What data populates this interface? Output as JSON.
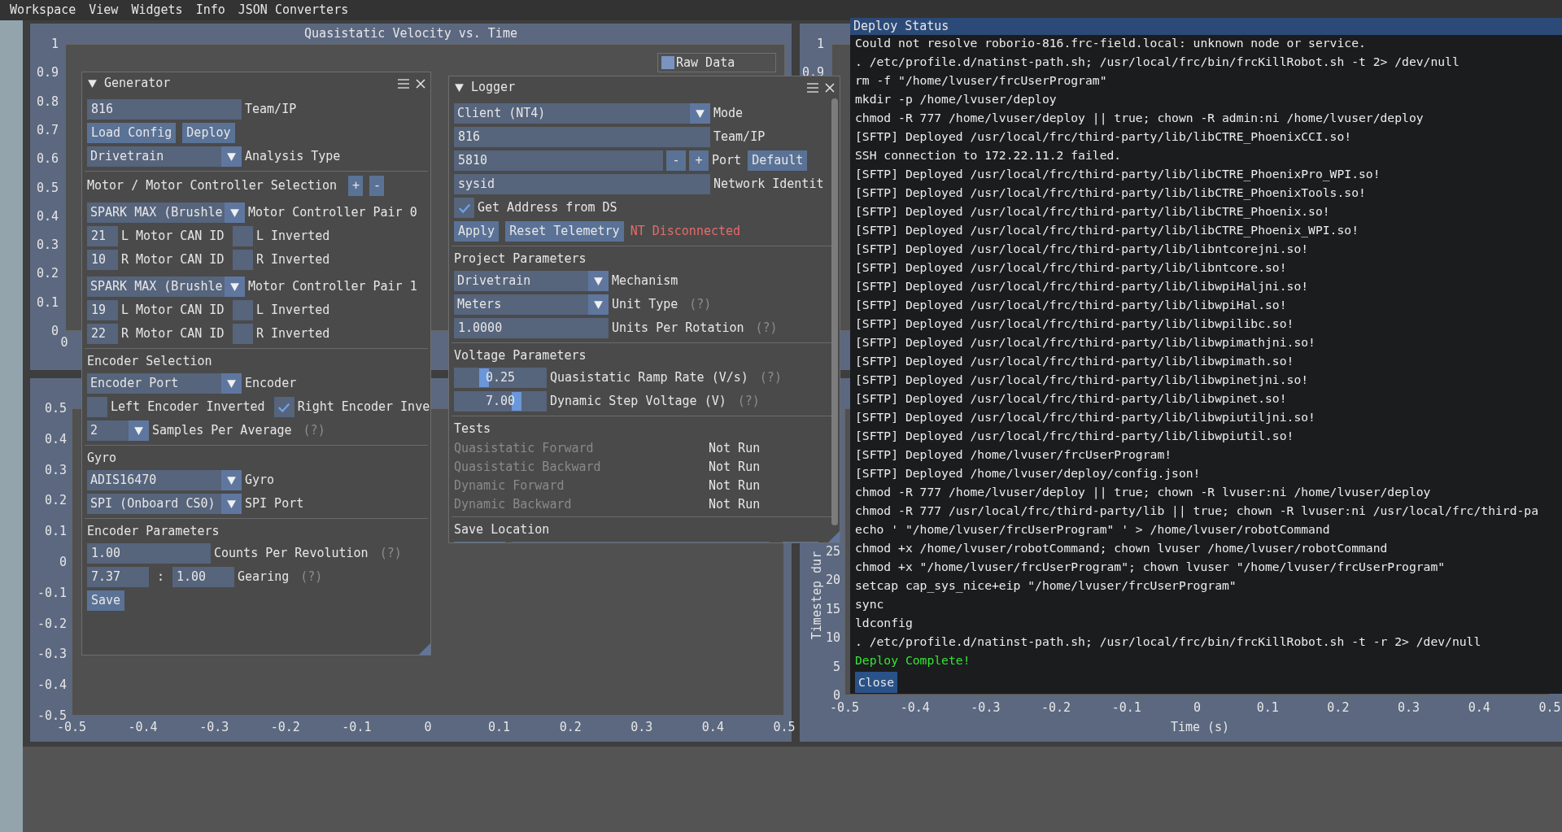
{
  "menu_bar": [
    "Workspace",
    "View",
    "Widgets",
    "Info",
    "JSON Converters"
  ],
  "plots": [
    {
      "title": "Quasistatic Velocity vs. Time",
      "y_ticks": [
        "1",
        "0.9",
        "0.8",
        "0.7",
        "0.6",
        "0.5",
        "0.4",
        "0.3",
        "0.2",
        "0.1",
        "0"
      ],
      "x_ticks": [
        "0"
      ],
      "legend": [
        {
          "label": "Raw Data",
          "color": "#7a93bf"
        }
      ]
    },
    {
      "y_ticks": [
        "1",
        "0.9"
      ]
    },
    {
      "y_ticks": [
        "0.5",
        "0.4",
        "0.3",
        "0.2",
        "0.1",
        "0",
        "-0.1",
        "-0.2",
        "-0.3",
        "-0.4",
        "-0.5"
      ],
      "x_ticks": [
        "-0.5",
        "-0.4",
        "-0.3",
        "-0.2",
        "-0.1",
        "0",
        "0.1",
        "0.2",
        "0.3",
        "0.4",
        "0.5"
      ]
    },
    {
      "y_ticks": [
        "25",
        "20",
        "15",
        "10",
        "5",
        "0"
      ],
      "ylabel": "Timestep dur",
      "x_ticks": [
        "-0.5",
        "-0.4",
        "-0.3",
        "-0.2",
        "-0.1",
        "0",
        "0.1",
        "0.2",
        "0.3",
        "0.4",
        "0.5"
      ],
      "xlabel": "Time (s)"
    }
  ],
  "generator": {
    "title": "Generator",
    "team_ip": {
      "value": "816",
      "label": "Team/IP"
    },
    "buttons": [
      "Load Config",
      "Deploy"
    ],
    "analysis_type": {
      "value": "Drivetrain",
      "label": "Analysis Type"
    },
    "motor_selection": {
      "heading": "Motor / Motor Controller Selection",
      "add": "+",
      "remove": "-",
      "pairs": [
        {
          "controller": "SPARK MAX (Brushle",
          "label": "Motor Controller Pair 0",
          "motors": [
            {
              "can_id": "21",
              "can_label": "L Motor CAN ID",
              "inverted": false,
              "inverted_label": "L Inverted"
            },
            {
              "can_id": "10",
              "can_label": "R Motor CAN ID",
              "inverted": false,
              "inverted_label": "R Inverted"
            }
          ]
        },
        {
          "controller": "SPARK MAX (Brushle",
          "label": "Motor Controller Pair 1",
          "motors": [
            {
              "can_id": "19",
              "can_label": "L Motor CAN ID",
              "inverted": false,
              "inverted_label": "L Inverted"
            },
            {
              "can_id": "22",
              "can_label": "R Motor CAN ID",
              "inverted": false,
              "inverted_label": "R Inverted"
            }
          ]
        }
      ]
    },
    "encoder_selection": {
      "heading": "Encoder Selection",
      "encoder": {
        "value": "Encoder Port",
        "label": "Encoder"
      },
      "checkboxes": [
        {
          "label": "Left Encoder Inverted",
          "checked": false
        },
        {
          "label": "Right Encoder Inve",
          "checked": true
        }
      ],
      "samples": {
        "value": "2",
        "label": "Samples Per Average",
        "help": "(?)"
      }
    },
    "gyro": {
      "heading": "Gyro",
      "combos": [
        {
          "value": "ADIS16470",
          "label": "Gyro"
        },
        {
          "value": "SPI (Onboard CS0)",
          "label": "SPI Port"
        }
      ]
    },
    "encoder_parameters": {
      "heading": "Encoder Parameters",
      "counts": {
        "value": "1.00",
        "label": "Counts Per Revolution",
        "help": "(?)"
      },
      "gearing": {
        "input": "7.37",
        "separator": ":",
        "output": "1.00",
        "label": "Gearing",
        "help": "(?)"
      },
      "save": "Save"
    }
  },
  "logger": {
    "title": "Logger",
    "mode": {
      "value": "Client (NT4)",
      "label": "Mode"
    },
    "team_ip": {
      "value": "816",
      "label": "Team/IP"
    },
    "port": {
      "value": "5810",
      "minus": "-",
      "plus": "+",
      "label": "Port",
      "default_button": "Default"
    },
    "network_identity": {
      "value": "sysid",
      "label": "Network Identit"
    },
    "get_address": {
      "label": "Get Address from DS",
      "checked": true
    },
    "buttons": [
      "Apply",
      "Reset Telemetry"
    ],
    "status": {
      "text": "NT Disconnected",
      "connected": false
    },
    "project_parameters": {
      "heading": "Project Parameters",
      "mechanism": {
        "value": "Drivetrain",
        "label": "Mechanism"
      },
      "unit_type": {
        "value": "Meters",
        "label": "Unit Type",
        "help": "(?)"
      },
      "units_per_rotation": {
        "value": "1.0000",
        "label": "Units Per Rotation",
        "help": "(?)"
      }
    },
    "voltage_parameters": {
      "heading": "Voltage Parameters",
      "sliders": [
        {
          "value": "0.25",
          "level": 0.3,
          "label": "Quasistatic Ramp Rate (V/s)",
          "help": "(?)"
        },
        {
          "value": "7.00",
          "level": 0.7,
          "label": "Dynamic Step Voltage (V)",
          "help": "(?)"
        }
      ]
    },
    "tests": {
      "heading": "Tests",
      "rows": [
        {
          "name": "Quasistatic Forward",
          "status": "Not Run",
          "disabled": true
        },
        {
          "name": "Quasistatic Backward",
          "status": "Not Run",
          "disabled": true
        },
        {
          "name": "Dynamic Forward",
          "status": "Not Run",
          "disabled": true
        },
        {
          "name": "Dynamic Backward",
          "status": "Not Run",
          "disabled": true
        }
      ]
    },
    "save_location": {
      "heading": "Save Location"
    }
  },
  "deploy_status": {
    "title": "Deploy Status",
    "lines": [
      {
        "text": "Could not resolve roborio-816.frc-field.local: unknown node or service.",
        "kind": "log"
      },
      {
        "text": ". /etc/profile.d/natinst-path.sh; /usr/local/frc/bin/frcKillRobot.sh -t 2> /dev/null",
        "kind": "log"
      },
      {
        "text": "rm -f \"/home/lvuser/frcUserProgram\"",
        "kind": "log"
      },
      {
        "text": "mkdir -p /home/lvuser/deploy",
        "kind": "log"
      },
      {
        "text": "chmod -R 777 /home/lvuser/deploy || true; chown -R admin:ni /home/lvuser/deploy",
        "kind": "log"
      },
      {
        "text": "[SFTP] Deployed /usr/local/frc/third-party/lib/libCTRE_PhoenixCCI.so!",
        "kind": "log"
      },
      {
        "text": "SSH connection to 172.22.11.2 failed.",
        "kind": "log"
      },
      {
        "text": "[SFTP] Deployed /usr/local/frc/third-party/lib/libCTRE_PhoenixPro_WPI.so!",
        "kind": "log"
      },
      {
        "text": "[SFTP] Deployed /usr/local/frc/third-party/lib/libCTRE_PhoenixTools.so!",
        "kind": "log"
      },
      {
        "text": "[SFTP] Deployed /usr/local/frc/third-party/lib/libCTRE_Phoenix.so!",
        "kind": "log"
      },
      {
        "text": "[SFTP] Deployed /usr/local/frc/third-party/lib/libCTRE_Phoenix_WPI.so!",
        "kind": "log"
      },
      {
        "text": "[SFTP] Deployed /usr/local/frc/third-party/lib/libntcorejni.so!",
        "kind": "log"
      },
      {
        "text": "[SFTP] Deployed /usr/local/frc/third-party/lib/libntcore.so!",
        "kind": "log"
      },
      {
        "text": "[SFTP] Deployed /usr/local/frc/third-party/lib/libwpiHaljni.so!",
        "kind": "log"
      },
      {
        "text": "[SFTP] Deployed /usr/local/frc/third-party/lib/libwpiHal.so!",
        "kind": "log"
      },
      {
        "text": "[SFTP] Deployed /usr/local/frc/third-party/lib/libwpilibc.so!",
        "kind": "log"
      },
      {
        "text": "[SFTP] Deployed /usr/local/frc/third-party/lib/libwpimathjni.so!",
        "kind": "log"
      },
      {
        "text": "[SFTP] Deployed /usr/local/frc/third-party/lib/libwpimath.so!",
        "kind": "log"
      },
      {
        "text": "[SFTP] Deployed /usr/local/frc/third-party/lib/libwpinetjni.so!",
        "kind": "log"
      },
      {
        "text": "[SFTP] Deployed /usr/local/frc/third-party/lib/libwpinet.so!",
        "kind": "log"
      },
      {
        "text": "[SFTP] Deployed /usr/local/frc/third-party/lib/libwpiutiljni.so!",
        "kind": "log"
      },
      {
        "text": "[SFTP] Deployed /usr/local/frc/third-party/lib/libwpiutil.so!",
        "kind": "log"
      },
      {
        "text": "[SFTP] Deployed /home/lvuser/frcUserProgram!",
        "kind": "log"
      },
      {
        "text": "[SFTP] Deployed /home/lvuser/deploy/config.json!",
        "kind": "log"
      },
      {
        "text": "chmod -R 777 /home/lvuser/deploy || true; chown -R lvuser:ni /home/lvuser/deploy",
        "kind": "log"
      },
      {
        "text": "chmod -R 777 /usr/local/frc/third-party/lib || true; chown -R lvuser:ni /usr/local/frc/third-pa",
        "kind": "log"
      },
      {
        "text": "echo ' \"/home/lvuser/frcUserProgram\" ' > /home/lvuser/robotCommand",
        "kind": "log"
      },
      {
        "text": "chmod +x /home/lvuser/robotCommand; chown lvuser /home/lvuser/robotCommand",
        "kind": "log"
      },
      {
        "text": "chmod +x \"/home/lvuser/frcUserProgram\"; chown lvuser \"/home/lvuser/frcUserProgram\"",
        "kind": "log"
      },
      {
        "text": "setcap cap_sys_nice+eip \"/home/lvuser/frcUserProgram\"",
        "kind": "log"
      },
      {
        "text": "sync",
        "kind": "log"
      },
      {
        "text": "ldconfig",
        "kind": "log"
      },
      {
        "text": ". /etc/profile.d/natinst-path.sh; /usr/local/frc/bin/frcKillRobot.sh -t -r 2> /dev/null",
        "kind": "log"
      },
      {
        "text": "Deploy Complete!",
        "kind": "success"
      }
    ],
    "close_button": "Close"
  }
}
